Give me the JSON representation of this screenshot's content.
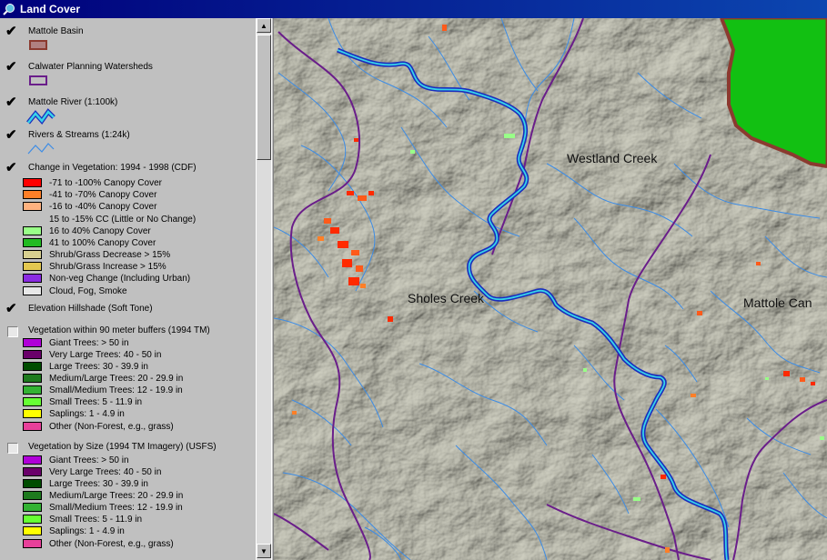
{
  "window": {
    "title": "Land Cover",
    "title_icon": "magnifier-globe-icon"
  },
  "legend": {
    "mattole_basin": {
      "label": "Mattole Basin",
      "checked": true
    },
    "calwater": {
      "label": "Calwater Planning Watersheds",
      "checked": true
    },
    "mattole_river": {
      "label": "Mattole River (1:100k)",
      "checked": true
    },
    "rivers_streams": {
      "label": "Rivers & Streams (1:24k)",
      "checked": true
    },
    "change_veg": {
      "label": "Change in Vegetation: 1994 - 1998 (CDF)",
      "checked": true,
      "classes": [
        {
          "label": "-71 to -100% Canopy Cover",
          "color": "#ff0000"
        },
        {
          "label": "-41 to -70% Canopy Cover",
          "color": "#ff7f27"
        },
        {
          "label": "-16 to -40% Canopy Cover",
          "color": "#ffb27f"
        },
        {
          "label": "15 to -15% CC (Little or No Change)",
          "color": "none"
        },
        {
          "label": "16 to 40% Canopy Cover",
          "color": "#99ff88"
        },
        {
          "label": "41 to 100% Canopy Cover",
          "color": "#22bb22"
        },
        {
          "label": "Shrub/Grass Decrease > 15%",
          "color": "#d8d090"
        },
        {
          "label": "Shrub/Grass Increase > 15%",
          "color": "#e4c850"
        },
        {
          "label": "Non-veg Change (Including Urban)",
          "color": "#8a2be2"
        },
        {
          "label": "Cloud, Fog, Smoke",
          "color": "#e8e8e8"
        }
      ]
    },
    "hillshade": {
      "label": "Elevation Hillshade (Soft Tone)",
      "checked": true
    },
    "veg_buffers": {
      "label": "Vegetation within 90 meter buffers (1994 TM)",
      "checked": false,
      "classes": [
        {
          "label": "Giant Trees: > 50 in",
          "color": "#b000d8"
        },
        {
          "label": "Very Large Trees: 40 - 50 in",
          "color": "#6a006a"
        },
        {
          "label": "Large Trees: 30 - 39.9 in",
          "color": "#004d00"
        },
        {
          "label": "Medium/Large Trees: 20 - 29.9 in",
          "color": "#1e7a1e"
        },
        {
          "label": "Small/Medium Trees: 12 - 19.9 in",
          "color": "#33b233"
        },
        {
          "label": "Small Trees: 5 - 11.9 in",
          "color": "#66ff33"
        },
        {
          "label": "Saplings: 1 - 4.9 in",
          "color": "#ffff00"
        },
        {
          "label": "Other (Non-Forest, e.g., grass)",
          "color": "#e8409a"
        }
      ]
    },
    "veg_size": {
      "label": "Vegetation by Size (1994 TM Imagery) (USFS)",
      "checked": false,
      "classes": [
        {
          "label": "Giant Trees: > 50 in",
          "color": "#b000d8"
        },
        {
          "label": "Very Large Trees: 40 - 50 in",
          "color": "#6a006a"
        },
        {
          "label": "Large Trees: 30 - 39.9 in",
          "color": "#004d00"
        },
        {
          "label": "Medium/Large Trees: 20 - 29.9 in",
          "color": "#1e7a1e"
        },
        {
          "label": "Small/Medium Trees: 12 - 19.9 in",
          "color": "#33b233"
        },
        {
          "label": "Small Trees: 5 - 11.9 in",
          "color": "#66ff33"
        },
        {
          "label": "Saplings: 1 - 4.9 in",
          "color": "#ffff00"
        },
        {
          "label": "Other (Non-Forest, e.g., grass)",
          "color": "#e8409a"
        }
      ]
    }
  },
  "map": {
    "labels": {
      "westland": "Westland Creek",
      "sholes": "Sholes Creek",
      "mattole_can": "Mattole Can"
    },
    "colors": {
      "terrain": "#a8a89a",
      "basin": "#8b3a2f",
      "watershed": "#6a1e8a",
      "river": "#1a2dbd",
      "river_core": "#37d3e8",
      "streams": "#3c8ce6",
      "green_area": "#12c012"
    }
  }
}
